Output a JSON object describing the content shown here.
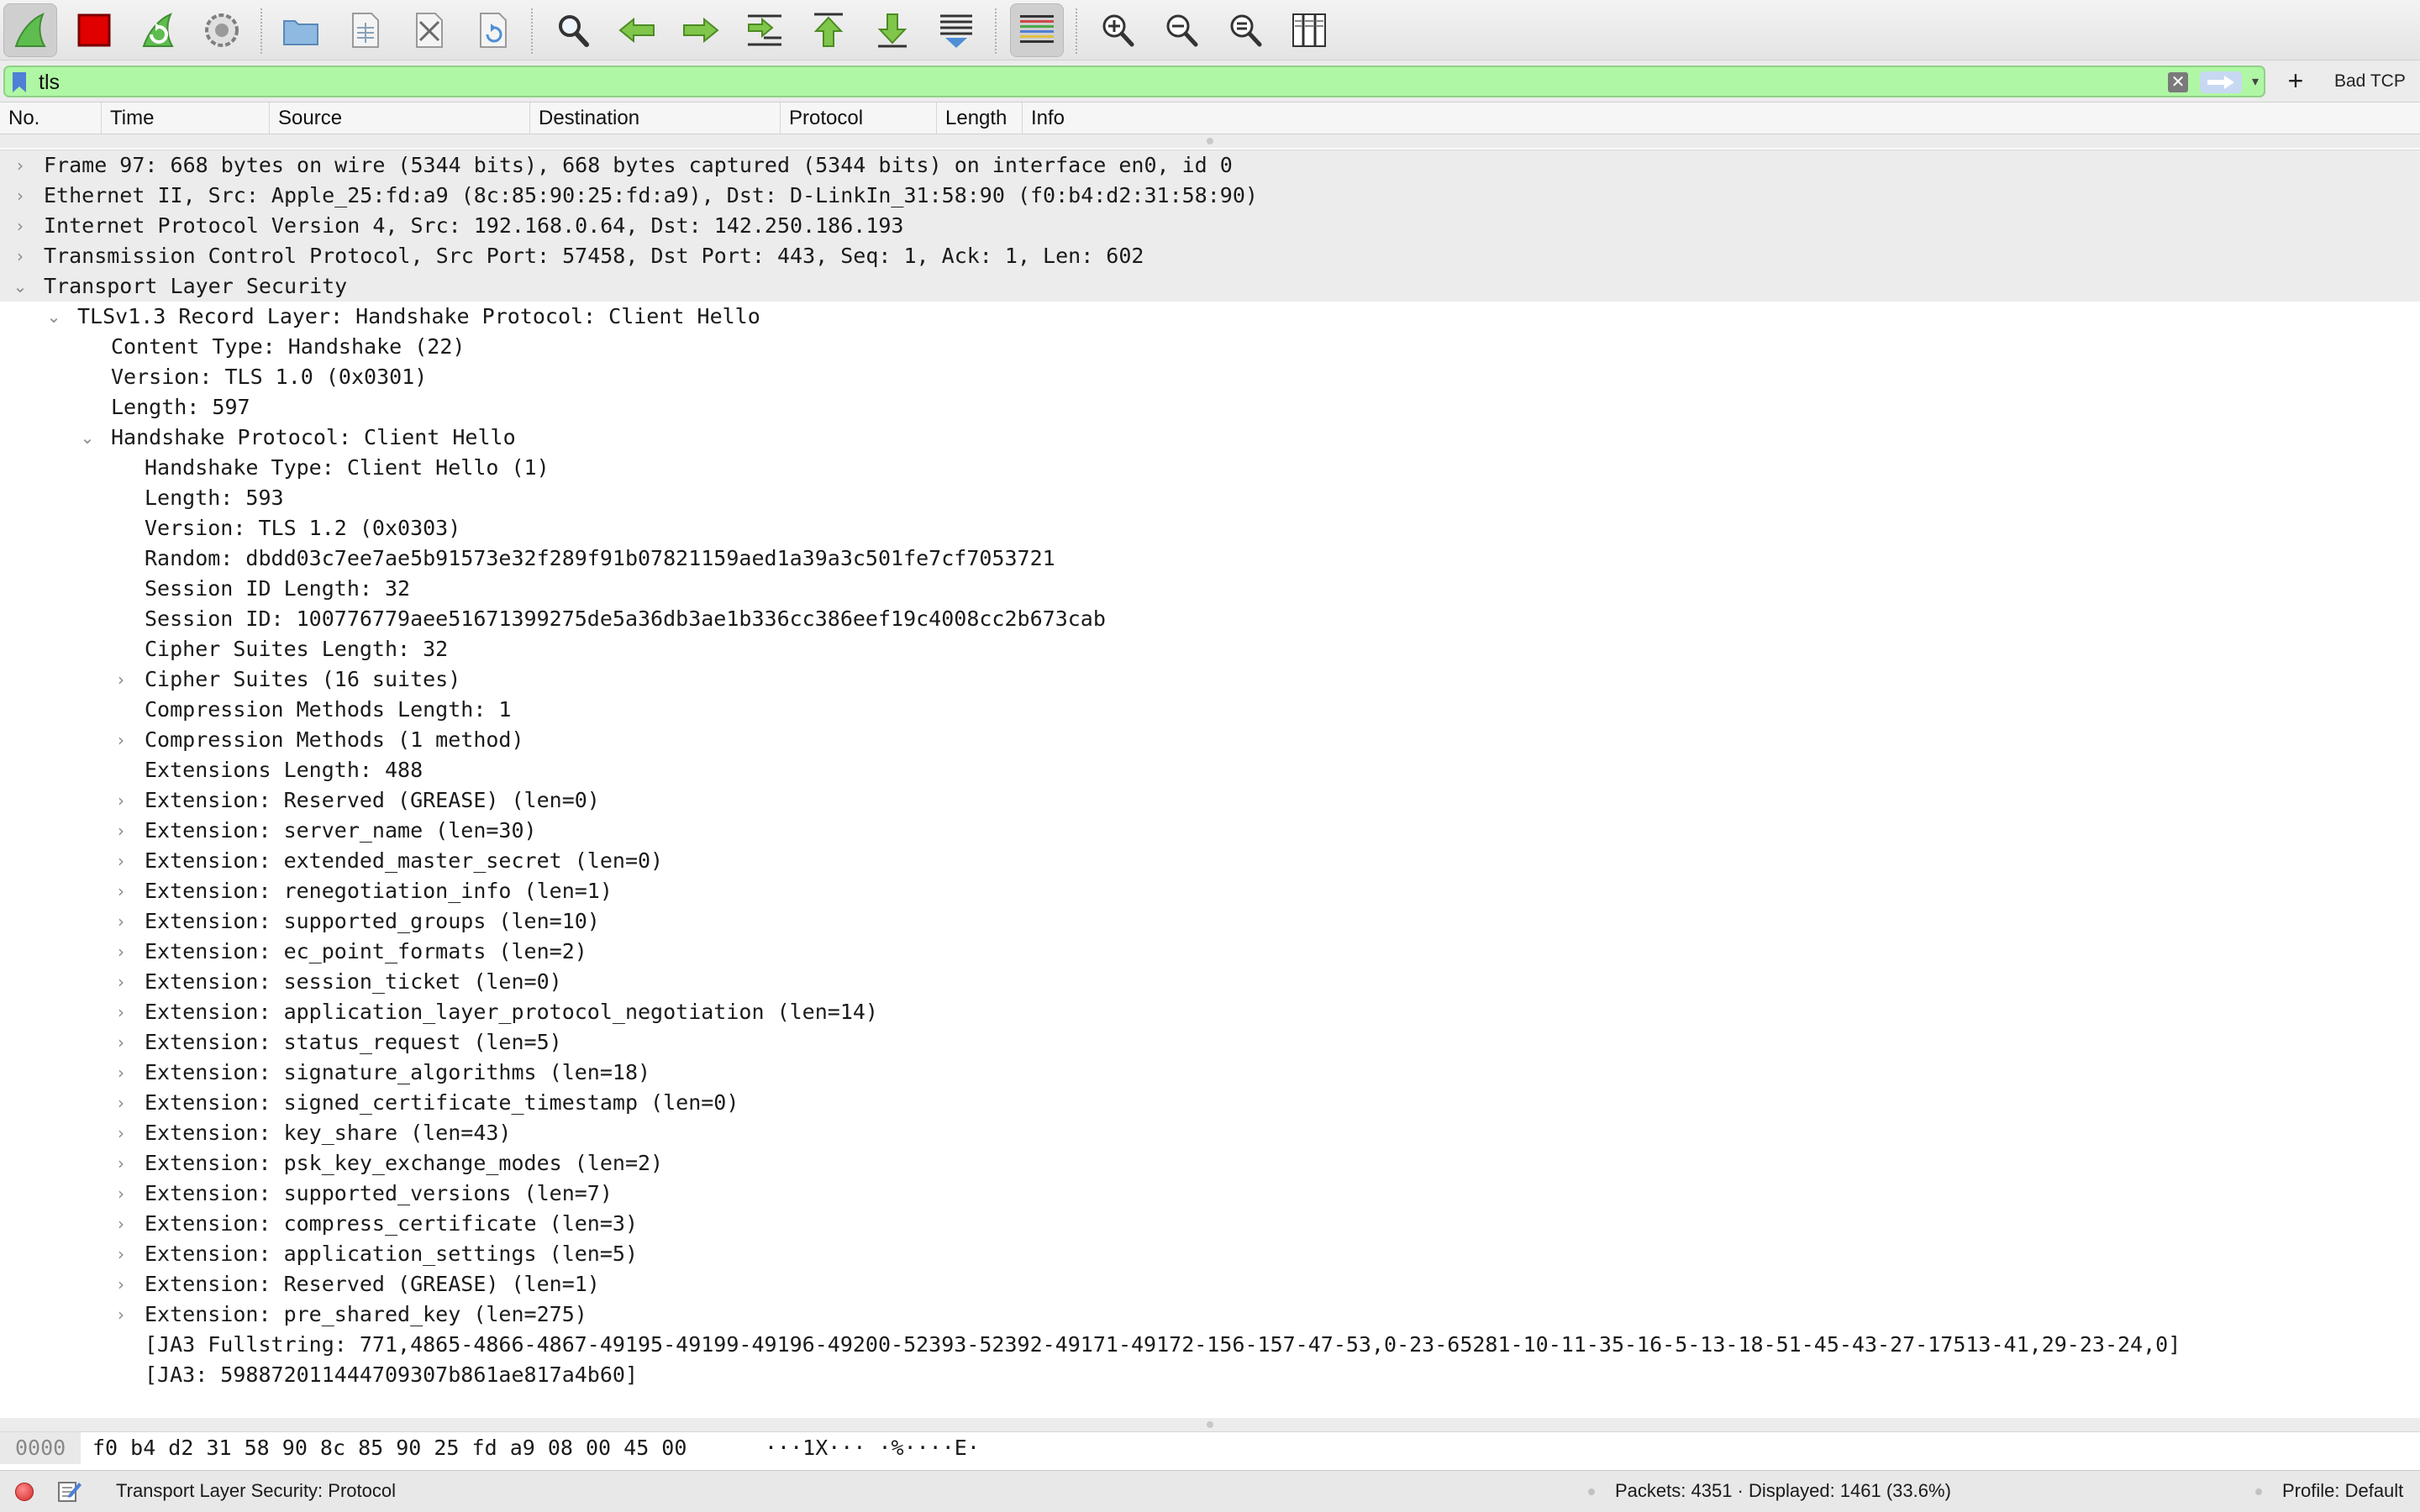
{
  "toolbar": {
    "buttons": [
      {
        "name": "start-capture-icon"
      },
      {
        "name": "stop-capture-icon"
      },
      {
        "name": "restart-capture-icon"
      },
      {
        "name": "capture-options-icon"
      },
      {
        "name": "open-file-icon"
      },
      {
        "name": "save-file-icon"
      },
      {
        "name": "close-file-icon"
      },
      {
        "name": "reload-file-icon"
      },
      {
        "name": "find-packet-icon"
      },
      {
        "name": "go-back-icon"
      },
      {
        "name": "go-forward-icon"
      },
      {
        "name": "go-to-packet-icon"
      },
      {
        "name": "go-first-packet-icon"
      },
      {
        "name": "go-last-packet-icon"
      },
      {
        "name": "auto-scroll-icon"
      },
      {
        "name": "colorize-icon"
      },
      {
        "name": "zoom-in-icon"
      },
      {
        "name": "zoom-out-icon"
      },
      {
        "name": "zoom-reset-icon"
      },
      {
        "name": "resize-columns-icon"
      }
    ]
  },
  "filter": {
    "value": "tls",
    "clear_label": "✕",
    "dropdown_label": "▾",
    "add_label": "+",
    "bad_tcp_label": "Bad TCP"
  },
  "columns": [
    "No.",
    "Time",
    "Source",
    "Destination",
    "Protocol",
    "Length",
    "Info"
  ],
  "details": [
    {
      "text": "Frame 97: 668 bytes on wire (5344 bits), 668 bytes captured (5344 bits) on interface en0, id 0",
      "indent": 0,
      "chevron": "›",
      "top": true
    },
    {
      "text": "Ethernet II, Src: Apple_25:fd:a9 (8c:85:90:25:fd:a9), Dst: D-LinkIn_31:58:90 (f0:b4:d2:31:58:90)",
      "indent": 0,
      "chevron": "›",
      "top": true
    },
    {
      "text": "Internet Protocol Version 4, Src: 192.168.0.64, Dst: 142.250.186.193",
      "indent": 0,
      "chevron": "›",
      "top": true
    },
    {
      "text": "Transmission Control Protocol, Src Port: 57458, Dst Port: 443, Seq: 1, Ack: 1, Len: 602",
      "indent": 0,
      "chevron": "›",
      "top": true
    },
    {
      "text": "Transport Layer Security",
      "indent": 0,
      "chevron": "⌄",
      "top": true
    },
    {
      "text": "TLSv1.3 Record Layer: Handshake Protocol: Client Hello",
      "indent": 1,
      "chevron": "⌄"
    },
    {
      "text": "Content Type: Handshake (22)",
      "indent": 2,
      "chevron": ""
    },
    {
      "text": "Version: TLS 1.0 (0x0301)",
      "indent": 2,
      "chevron": ""
    },
    {
      "text": "Length: 597",
      "indent": 2,
      "chevron": ""
    },
    {
      "text": "Handshake Protocol: Client Hello",
      "indent": 2,
      "chevron": "⌄"
    },
    {
      "text": "Handshake Type: Client Hello (1)",
      "indent": 3,
      "chevron": ""
    },
    {
      "text": "Length: 593",
      "indent": 3,
      "chevron": ""
    },
    {
      "text": "Version: TLS 1.2 (0x0303)",
      "indent": 3,
      "chevron": ""
    },
    {
      "text": "Random: dbdd03c7ee7ae5b91573e32f289f91b07821159aed1a39a3c501fe7cf7053721",
      "indent": 3,
      "chevron": ""
    },
    {
      "text": "Session ID Length: 32",
      "indent": 3,
      "chevron": ""
    },
    {
      "text": "Session ID: 100776779aee51671399275de5a36db3ae1b336cc386eef19c4008cc2b673cab",
      "indent": 3,
      "chevron": ""
    },
    {
      "text": "Cipher Suites Length: 32",
      "indent": 3,
      "chevron": ""
    },
    {
      "text": "Cipher Suites (16 suites)",
      "indent": 3,
      "chevron": "›"
    },
    {
      "text": "Compression Methods Length: 1",
      "indent": 3,
      "chevron": ""
    },
    {
      "text": "Compression Methods (1 method)",
      "indent": 3,
      "chevron": "›"
    },
    {
      "text": "Extensions Length: 488",
      "indent": 3,
      "chevron": ""
    },
    {
      "text": "Extension: Reserved (GREASE) (len=0)",
      "indent": 3,
      "chevron": "›"
    },
    {
      "text": "Extension: server_name (len=30)",
      "indent": 3,
      "chevron": "›"
    },
    {
      "text": "Extension: extended_master_secret (len=0)",
      "indent": 3,
      "chevron": "›"
    },
    {
      "text": "Extension: renegotiation_info (len=1)",
      "indent": 3,
      "chevron": "›"
    },
    {
      "text": "Extension: supported_groups (len=10)",
      "indent": 3,
      "chevron": "›"
    },
    {
      "text": "Extension: ec_point_formats (len=2)",
      "indent": 3,
      "chevron": "›"
    },
    {
      "text": "Extension: session_ticket (len=0)",
      "indent": 3,
      "chevron": "›"
    },
    {
      "text": "Extension: application_layer_protocol_negotiation (len=14)",
      "indent": 3,
      "chevron": "›"
    },
    {
      "text": "Extension: status_request (len=5)",
      "indent": 3,
      "chevron": "›"
    },
    {
      "text": "Extension: signature_algorithms (len=18)",
      "indent": 3,
      "chevron": "›"
    },
    {
      "text": "Extension: signed_certificate_timestamp (len=0)",
      "indent": 3,
      "chevron": "›"
    },
    {
      "text": "Extension: key_share (len=43)",
      "indent": 3,
      "chevron": "›"
    },
    {
      "text": "Extension: psk_key_exchange_modes (len=2)",
      "indent": 3,
      "chevron": "›"
    },
    {
      "text": "Extension: supported_versions (len=7)",
      "indent": 3,
      "chevron": "›"
    },
    {
      "text": "Extension: compress_certificate (len=3)",
      "indent": 3,
      "chevron": "›"
    },
    {
      "text": "Extension: application_settings (len=5)",
      "indent": 3,
      "chevron": "›"
    },
    {
      "text": "Extension: Reserved (GREASE) (len=1)",
      "indent": 3,
      "chevron": "›"
    },
    {
      "text": "Extension: pre_shared_key (len=275)",
      "indent": 3,
      "chevron": "›"
    },
    {
      "text": "[JA3 Fullstring: 771,4865-4866-4867-49195-49199-49196-49200-52393-52392-49171-49172-156-157-47-53,0-23-65281-10-11-35-16-5-13-18-51-45-43-27-17513-41,29-23-24,0]",
      "indent": 3,
      "chevron": ""
    },
    {
      "text": "[JA3: 598872011444709307b861ae817a4b60]",
      "indent": 3,
      "chevron": ""
    }
  ],
  "bytes": {
    "offset": "0000",
    "hex": "f0 b4 d2 31 58 90 8c 85  90 25 fd a9 08 00 45 00",
    "ascii": "···1X··· ·%····E·"
  },
  "status": {
    "field": "Transport Layer Security: Protocol",
    "packets": "Packets: 4351 · Displayed: 1461 (33.6%)",
    "profile": "Profile: Default"
  },
  "colors": {
    "filter_valid": "#aff7a4",
    "top_level_row": "#ececec",
    "stop_red": "#e00000",
    "shark_green": "#5fbd4f"
  }
}
